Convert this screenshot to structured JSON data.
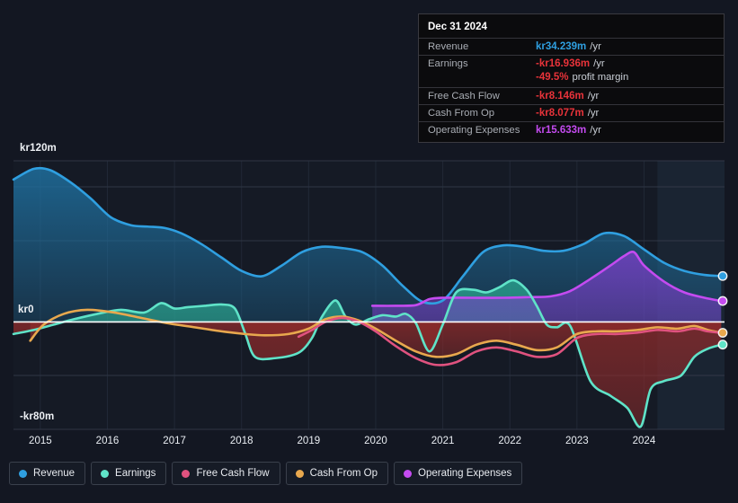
{
  "tooltip": {
    "title": "Dec 31 2024",
    "rows": [
      {
        "label": "Revenue",
        "value": "kr34.239m",
        "unit": "/yr",
        "color": "#2f9fe0"
      },
      {
        "label": "Earnings",
        "value": "-kr16.936m",
        "unit": "/yr",
        "color": "#e8333a"
      },
      {
        "label": "",
        "value": "-49.5%",
        "unit": "profit margin",
        "color": "#e8333a",
        "sub": true
      },
      {
        "label": "Free Cash Flow",
        "value": "-kr8.146m",
        "unit": "/yr",
        "color": "#e8333a"
      },
      {
        "label": "Cash From Op",
        "value": "-kr8.077m",
        "unit": "/yr",
        "color": "#e8333a"
      },
      {
        "label": "Operating Expenses",
        "value": "kr15.633m",
        "unit": "/yr",
        "color": "#c44bf0"
      }
    ]
  },
  "legend": {
    "items": [
      {
        "label": "Revenue",
        "color": "#2f9fe0"
      },
      {
        "label": "Earnings",
        "color": "#5fe3c8"
      },
      {
        "label": "Free Cash Flow",
        "color": "#e0527f"
      },
      {
        "label": "Cash From Op",
        "color": "#e8a84e"
      },
      {
        "label": "Operating Expenses",
        "color": "#c44bf0"
      }
    ]
  },
  "chart_data": {
    "type": "area",
    "title": "",
    "xlabel": "",
    "ylabel": "",
    "ylim": [
      -80,
      120
    ],
    "y_ticks": [
      120,
      0,
      -80
    ],
    "y_tick_labels": [
      "kr120m",
      "kr0",
      "-kr80m"
    ],
    "grid": true,
    "zero_line": 0,
    "x_ticks": [
      2015,
      2016,
      2017,
      2018,
      2019,
      2020,
      2021,
      2022,
      2023,
      2024
    ],
    "x_tick_labels": [
      "2015",
      "2016",
      "2017",
      "2018",
      "2019",
      "2020",
      "2021",
      "2022",
      "2023",
      "2024"
    ],
    "x_range": [
      2014.6,
      2025.2
    ],
    "forecast_start": 2024.2,
    "currency_prefix": "kr",
    "units": "m",
    "legend_position": "bottom",
    "series": [
      {
        "name": "Revenue",
        "color": "#2f9fe0",
        "fill": true,
        "x": [
          2014.6,
          2014.9,
          2015.15,
          2015.45,
          2015.75,
          2016.05,
          2016.35,
          2016.6,
          2016.85,
          2017.1,
          2017.4,
          2017.7,
          2018.0,
          2018.3,
          2018.6,
          2018.9,
          2019.2,
          2019.5,
          2019.8,
          2020.1,
          2020.4,
          2020.7,
          2021.0,
          2021.3,
          2021.6,
          2021.9,
          2022.2,
          2022.5,
          2022.8,
          2023.1,
          2023.4,
          2023.7,
          2024.0,
          2024.3,
          2024.6,
          2024.9,
          2025.15
        ],
        "values": [
          106.0,
          114.0,
          113.0,
          104.0,
          92.0,
          78.0,
          72.0,
          71.0,
          70.0,
          66.0,
          58.0,
          48.0,
          38.0,
          34.0,
          42.0,
          52.0,
          56.0,
          55.0,
          52.0,
          42.0,
          27.0,
          15.0,
          16.0,
          34.0,
          52.0,
          57.0,
          56.0,
          53.0,
          53.0,
          58.0,
          66.0,
          64.0,
          54.0,
          44.0,
          38.0,
          35.0,
          34.2
        ]
      },
      {
        "name": "Earnings",
        "color": "#5fe3c8",
        "fill": true,
        "x": [
          2014.6,
          2014.9,
          2015.2,
          2015.5,
          2015.85,
          2016.2,
          2016.55,
          2016.8,
          2017.0,
          2017.2,
          2017.45,
          2017.7,
          2017.9,
          2018.05,
          2018.2,
          2018.5,
          2018.85,
          2019.05,
          2019.2,
          2019.4,
          2019.55,
          2019.7,
          2019.9,
          2020.1,
          2020.3,
          2020.45,
          2020.6,
          2020.8,
          2021.0,
          2021.2,
          2021.45,
          2021.65,
          2021.85,
          2022.05,
          2022.25,
          2022.4,
          2022.55,
          2022.7,
          2022.9,
          2023.2,
          2023.5,
          2023.75,
          2023.95,
          2024.1,
          2024.3,
          2024.55,
          2024.75,
          2024.95,
          2025.15
        ],
        "values": [
          -9.0,
          -6.0,
          -2.0,
          2.0,
          6.0,
          9.0,
          7.0,
          14.0,
          10.0,
          11.0,
          12.0,
          13.0,
          10.0,
          -8.0,
          -26.0,
          -27.0,
          -23.0,
          -12.0,
          4.0,
          16.0,
          4.0,
          -2.0,
          2.0,
          5.0,
          4.0,
          6.0,
          -1.0,
          -22.0,
          -2.0,
          22.0,
          24.0,
          22.0,
          26.0,
          31.0,
          24.0,
          12.0,
          -2.0,
          -4.0,
          -3.0,
          -44.0,
          -55.0,
          -64.0,
          -78.0,
          -50.0,
          -44.0,
          -40.0,
          -26.0,
          -20.0,
          -17.0
        ]
      },
      {
        "name": "Operating Expenses",
        "color": "#c44bf0",
        "fill": true,
        "x": [
          2019.95,
          2020.3,
          2020.6,
          2020.8,
          2021.0,
          2021.4,
          2021.9,
          2022.3,
          2022.6,
          2022.9,
          2023.2,
          2023.5,
          2023.7,
          2023.85,
          2024.0,
          2024.3,
          2024.6,
          2024.9,
          2025.15
        ],
        "values": [
          12.0,
          12.0,
          12.5,
          17.0,
          18.0,
          18.0,
          18.0,
          18.5,
          19.0,
          23.0,
          32.0,
          42.0,
          49.0,
          52.0,
          42.0,
          30.0,
          22.0,
          18.0,
          15.6
        ]
      },
      {
        "name": "Cash From Op",
        "color": "#e8a84e",
        "fill": false,
        "x": [
          2014.85,
          2015.05,
          2015.35,
          2015.7,
          2016.1,
          2016.5,
          2016.9,
          2017.3,
          2017.7,
          2018.05,
          2018.35,
          2018.7,
          2019.0,
          2019.25,
          2019.5,
          2019.75,
          2020.0,
          2020.3,
          2020.6,
          2020.9,
          2021.2,
          2021.5,
          2021.8,
          2022.1,
          2022.4,
          2022.7,
          2023.0,
          2023.3,
          2023.6,
          2023.9,
          2024.2,
          2024.5,
          2024.75,
          2024.95,
          2025.15
        ],
        "values": [
          -14.0,
          -2.0,
          6.0,
          9.0,
          7.0,
          3.0,
          -1.0,
          -4.0,
          -7.0,
          -9.0,
          -10.0,
          -9.0,
          -5.0,
          2.0,
          4.0,
          1.0,
          -5.0,
          -14.0,
          -22.0,
          -26.0,
          -24.0,
          -17.0,
          -14.0,
          -17.0,
          -21.0,
          -19.0,
          -9.0,
          -7.0,
          -7.0,
          -6.0,
          -4.0,
          -5.0,
          -3.0,
          -6.0,
          -8.1
        ]
      },
      {
        "name": "Free Cash Flow",
        "color": "#e0527f",
        "fill": false,
        "x": [
          2018.85,
          2019.05,
          2019.25,
          2019.5,
          2019.75,
          2020.0,
          2020.3,
          2020.6,
          2020.9,
          2021.2,
          2021.5,
          2021.8,
          2022.1,
          2022.4,
          2022.7,
          2023.0,
          2023.3,
          2023.6,
          2023.9,
          2024.2,
          2024.5,
          2024.75,
          2024.95,
          2025.15
        ],
        "values": [
          -11.0,
          -6.0,
          0.0,
          3.0,
          0.0,
          -7.0,
          -18.0,
          -27.0,
          -32.0,
          -30.0,
          -22.0,
          -19.0,
          -22.0,
          -26.0,
          -24.0,
          -12.0,
          -9.0,
          -9.0,
          -8.0,
          -6.0,
          -7.0,
          -5.0,
          -7.0,
          -8.1
        ]
      }
    ],
    "endpoints": [
      {
        "name": "Revenue",
        "value": 34.2,
        "color": "#2f9fe0"
      },
      {
        "name": "Operating Expenses",
        "value": 15.6,
        "color": "#c44bf0"
      },
      {
        "name": "Cash From Op",
        "value": -8.1,
        "color": "#e8a84e"
      },
      {
        "name": "Earnings",
        "value": -16.9,
        "color": "#5fe3c8"
      }
    ]
  }
}
